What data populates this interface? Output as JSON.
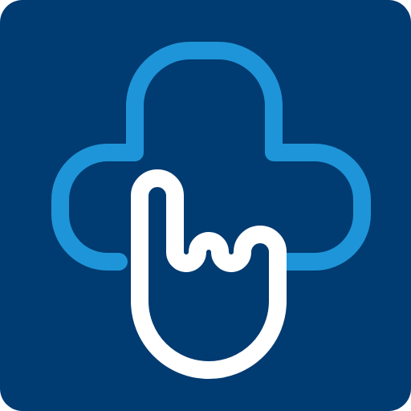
{
  "icon": {
    "name": "medical-cross-tap-icon",
    "colors": {
      "background": "#003B71",
      "cross_outline": "#1E95D8",
      "hand_outline": "#FFFFFF"
    }
  }
}
